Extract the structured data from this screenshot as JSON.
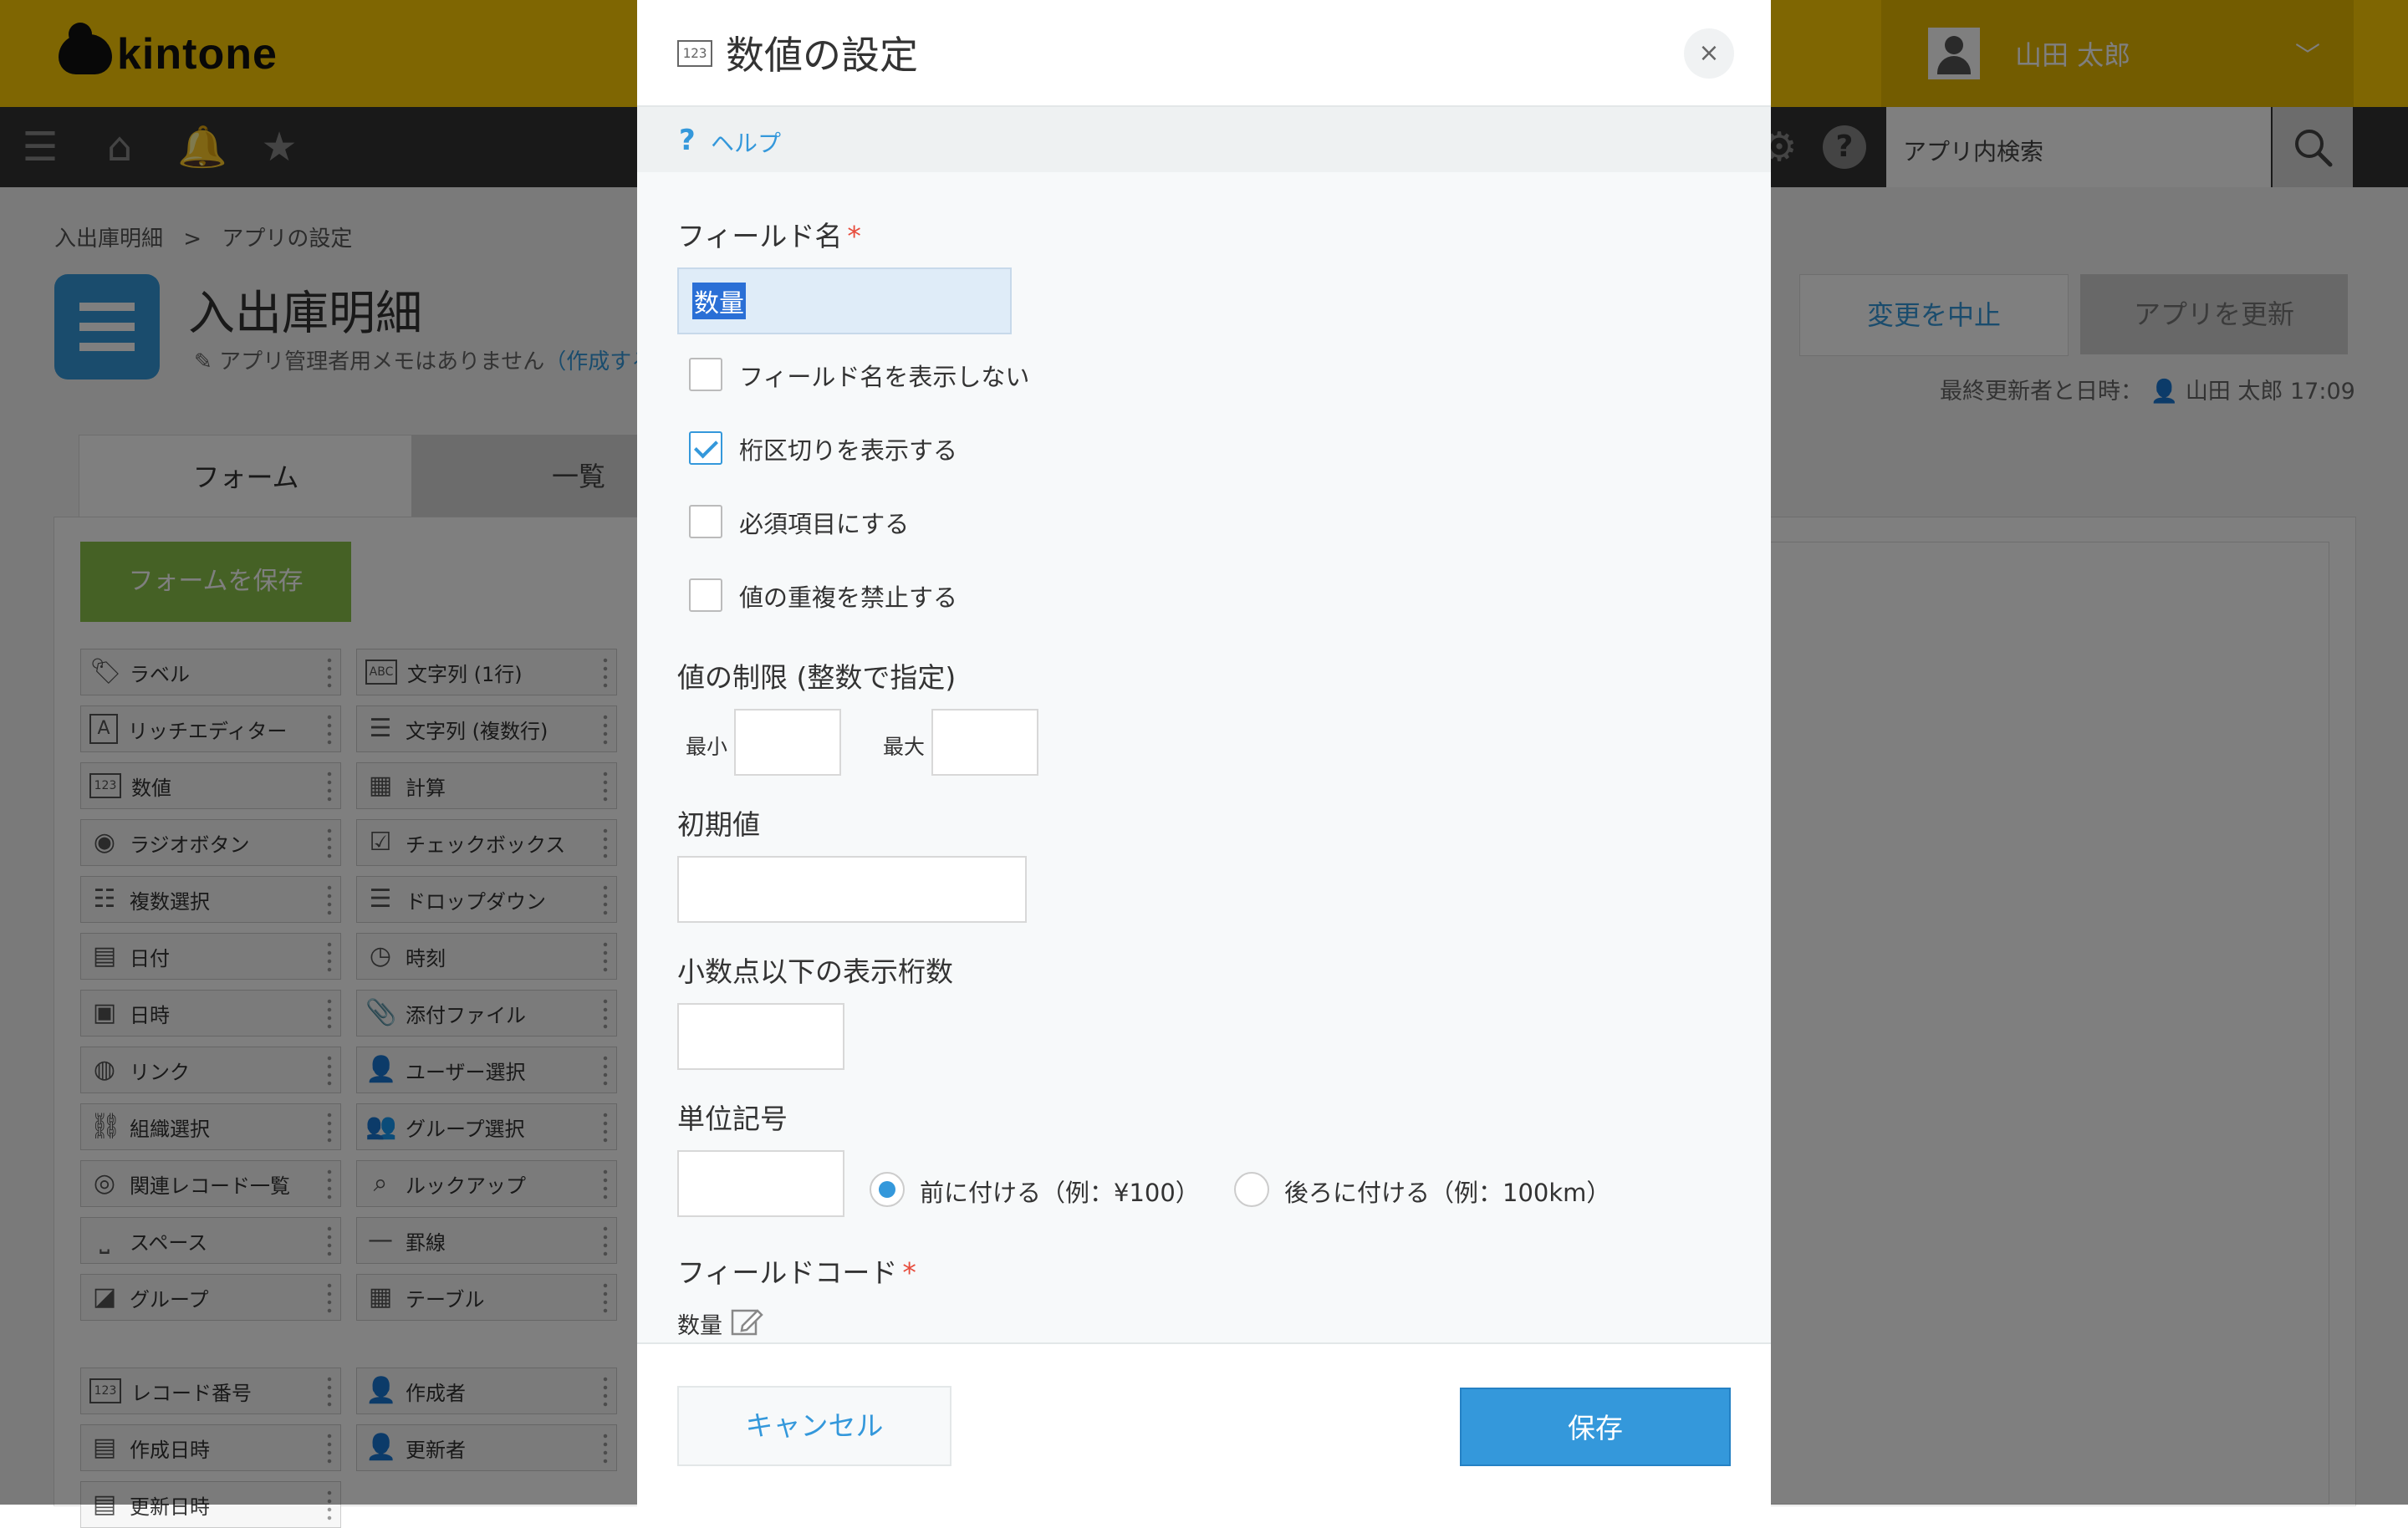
{
  "header": {
    "logo_text": "kintone",
    "user_name": "山田 太郎",
    "search_placeholder": "アプリ内検索"
  },
  "app": {
    "breadcrumb": [
      "入出庫明細",
      ">",
      "アプリの設定"
    ],
    "title": "入出庫明細",
    "memo_text": "アプリ管理者用メモはありません",
    "memo_link": "（作成する）",
    "abort_button": "変更を中止",
    "update_button": "アプリを更新",
    "last_update_label": "最終更新者と日時：",
    "last_update_user": "山田 太郎",
    "last_update_time": "17:09",
    "tabs": [
      "フォーム",
      "一覧"
    ],
    "save_form_button": "フォームを保存",
    "palette": [
      {
        "label": "ラベル",
        "icon": "tag-icon"
      },
      {
        "label": "文字列 (1行)",
        "icon": "abc-icon"
      },
      {
        "label": "リッチエディター",
        "icon": "rich-text-icon"
      },
      {
        "label": "文字列 (複数行)",
        "icon": "multiline-icon"
      },
      {
        "label": "数値",
        "icon": "number-icon"
      },
      {
        "label": "計算",
        "icon": "calculator-icon"
      },
      {
        "label": "ラジオボタン",
        "icon": "radio-icon"
      },
      {
        "label": "チェックボックス",
        "icon": "checkbox-icon"
      },
      {
        "label": "複数選択",
        "icon": "multi-select-icon"
      },
      {
        "label": "ドロップダウン",
        "icon": "dropdown-icon"
      },
      {
        "label": "日付",
        "icon": "calendar-icon"
      },
      {
        "label": "時刻",
        "icon": "clock-icon"
      },
      {
        "label": "日時",
        "icon": "datetime-icon"
      },
      {
        "label": "添付ファイル",
        "icon": "paperclip-icon"
      },
      {
        "label": "リンク",
        "icon": "globe-icon"
      },
      {
        "label": "ユーザー選択",
        "icon": "user-icon"
      },
      {
        "label": "組織選択",
        "icon": "org-icon"
      },
      {
        "label": "グループ選択",
        "icon": "group-icon"
      },
      {
        "label": "関連レコード一覧",
        "icon": "related-records-icon"
      },
      {
        "label": "ルックアップ",
        "icon": "lookup-icon"
      },
      {
        "label": "スペース",
        "icon": "space-icon"
      },
      {
        "label": "罫線",
        "icon": "line-icon"
      },
      {
        "label": "グループ",
        "icon": "group-field-icon"
      },
      {
        "label": "テーブル",
        "icon": "table-icon"
      },
      {
        "label": "レコード番号",
        "icon": "record-number-icon"
      },
      {
        "label": "作成者",
        "icon": "user-icon"
      },
      {
        "label": "作成日時",
        "icon": "calendar-icon"
      },
      {
        "label": "更新者",
        "icon": "user-icon"
      },
      {
        "label": "更新日時",
        "icon": "calendar-icon"
      }
    ]
  },
  "dialog": {
    "title_icon_text": "123",
    "title": "数値の設定",
    "close": "×",
    "help_icon": "?",
    "help": "ヘルプ",
    "field_name_label": "フィールド名",
    "required_mark": "*",
    "field_name_value": "数量",
    "checkboxes": [
      {
        "label": "フィールド名を表示しない",
        "checked": false
      },
      {
        "label": "桁区切りを表示する",
        "checked": true
      },
      {
        "label": "必須項目にする",
        "checked": false
      },
      {
        "label": "値の重複を禁止する",
        "checked": false
      }
    ],
    "limit_label": "値の制限 (整数で指定)",
    "min_label": "最小",
    "max_label": "最大",
    "min_value": "",
    "max_value": "",
    "default_label": "初期値",
    "default_value": "",
    "decimals_label": "小数点以下の表示桁数",
    "decimals_value": "",
    "unit_label": "単位記号",
    "unit_value": "",
    "unit_before": "前に付ける（例：¥100）",
    "unit_after": "後ろに付ける（例：100km）",
    "unit_position_selected": "before",
    "field_code_label": "フィールドコード",
    "field_code_value": "数量",
    "cancel_button": "キャンセル",
    "save_button": "保存"
  },
  "colors": {
    "header_yellow": "#fecd05",
    "accent_blue": "#3498db",
    "required_red": "#e74c3c",
    "save_form_green": "#8bc34a"
  }
}
